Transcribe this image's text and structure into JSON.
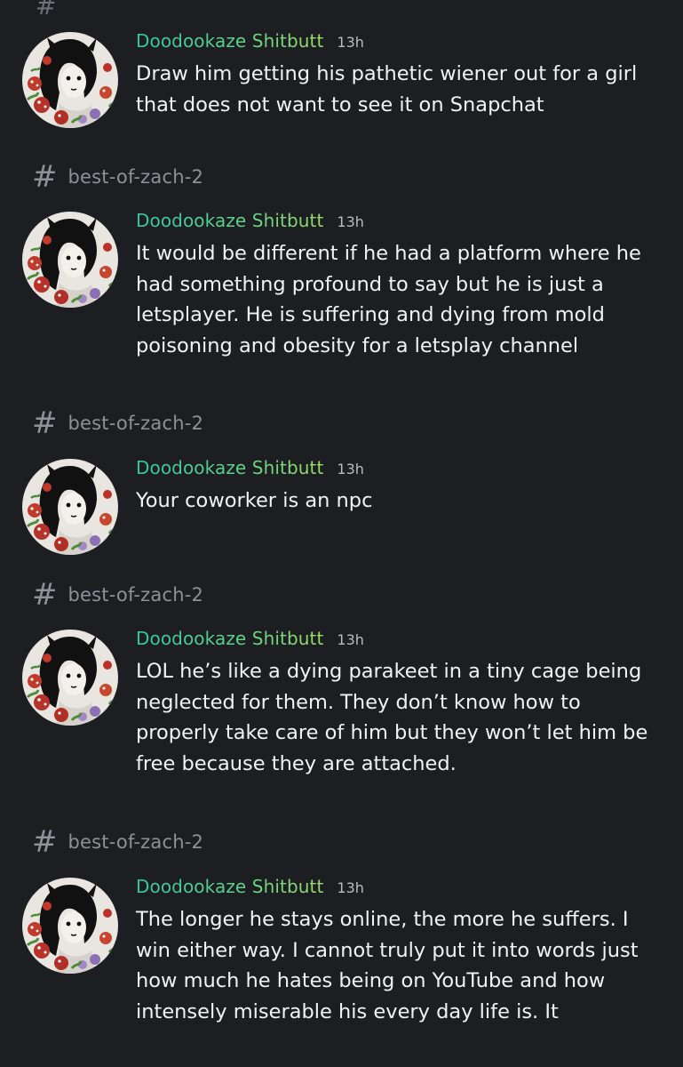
{
  "colors": {
    "background": "#1d1e22",
    "username_gradient_start": "#33c6a3",
    "username_gradient_end": "#9bdc6a",
    "message_text": "#f1f2f4",
    "muted_text": "#8e9098"
  },
  "icons": {
    "channel": "hash-icon",
    "avatar": "mushroom-girl-avatar"
  },
  "top_stub": "#",
  "messages": [
    {
      "username": "Doodookaze Shitbutt",
      "timestamp": "13h",
      "text": "Draw him getting his pathetic wiener out for a girl that does not want to see it on Snapchat"
    },
    {
      "channel": "best-of-zach-2",
      "username": "Doodookaze Shitbutt",
      "timestamp": "13h",
      "text": "It would be different if he had a platform where he had something profound to say but he is just a letsplayer. He is suffering and dying from mold poisoning and obesity for a letsplay channel"
    },
    {
      "channel": "best-of-zach-2",
      "username": "Doodookaze Shitbutt",
      "timestamp": "13h",
      "text": "Your coworker is an npc"
    },
    {
      "channel": "best-of-zach-2",
      "username": "Doodookaze Shitbutt",
      "timestamp": "13h",
      "text": "LOL he’s like a dying parakeet in a tiny cage being neglected for them. They don’t know how to properly take care of him but they won’t let him be free because they are attached."
    },
    {
      "channel": "best-of-zach-2",
      "username": "Doodookaze Shitbutt",
      "timestamp": "13h",
      "text": "The longer he stays online, the more he suffers. I win either way. I cannot truly put it into words just how much he hates being on YouTube and how intensely miserable his every day life is. It"
    }
  ]
}
